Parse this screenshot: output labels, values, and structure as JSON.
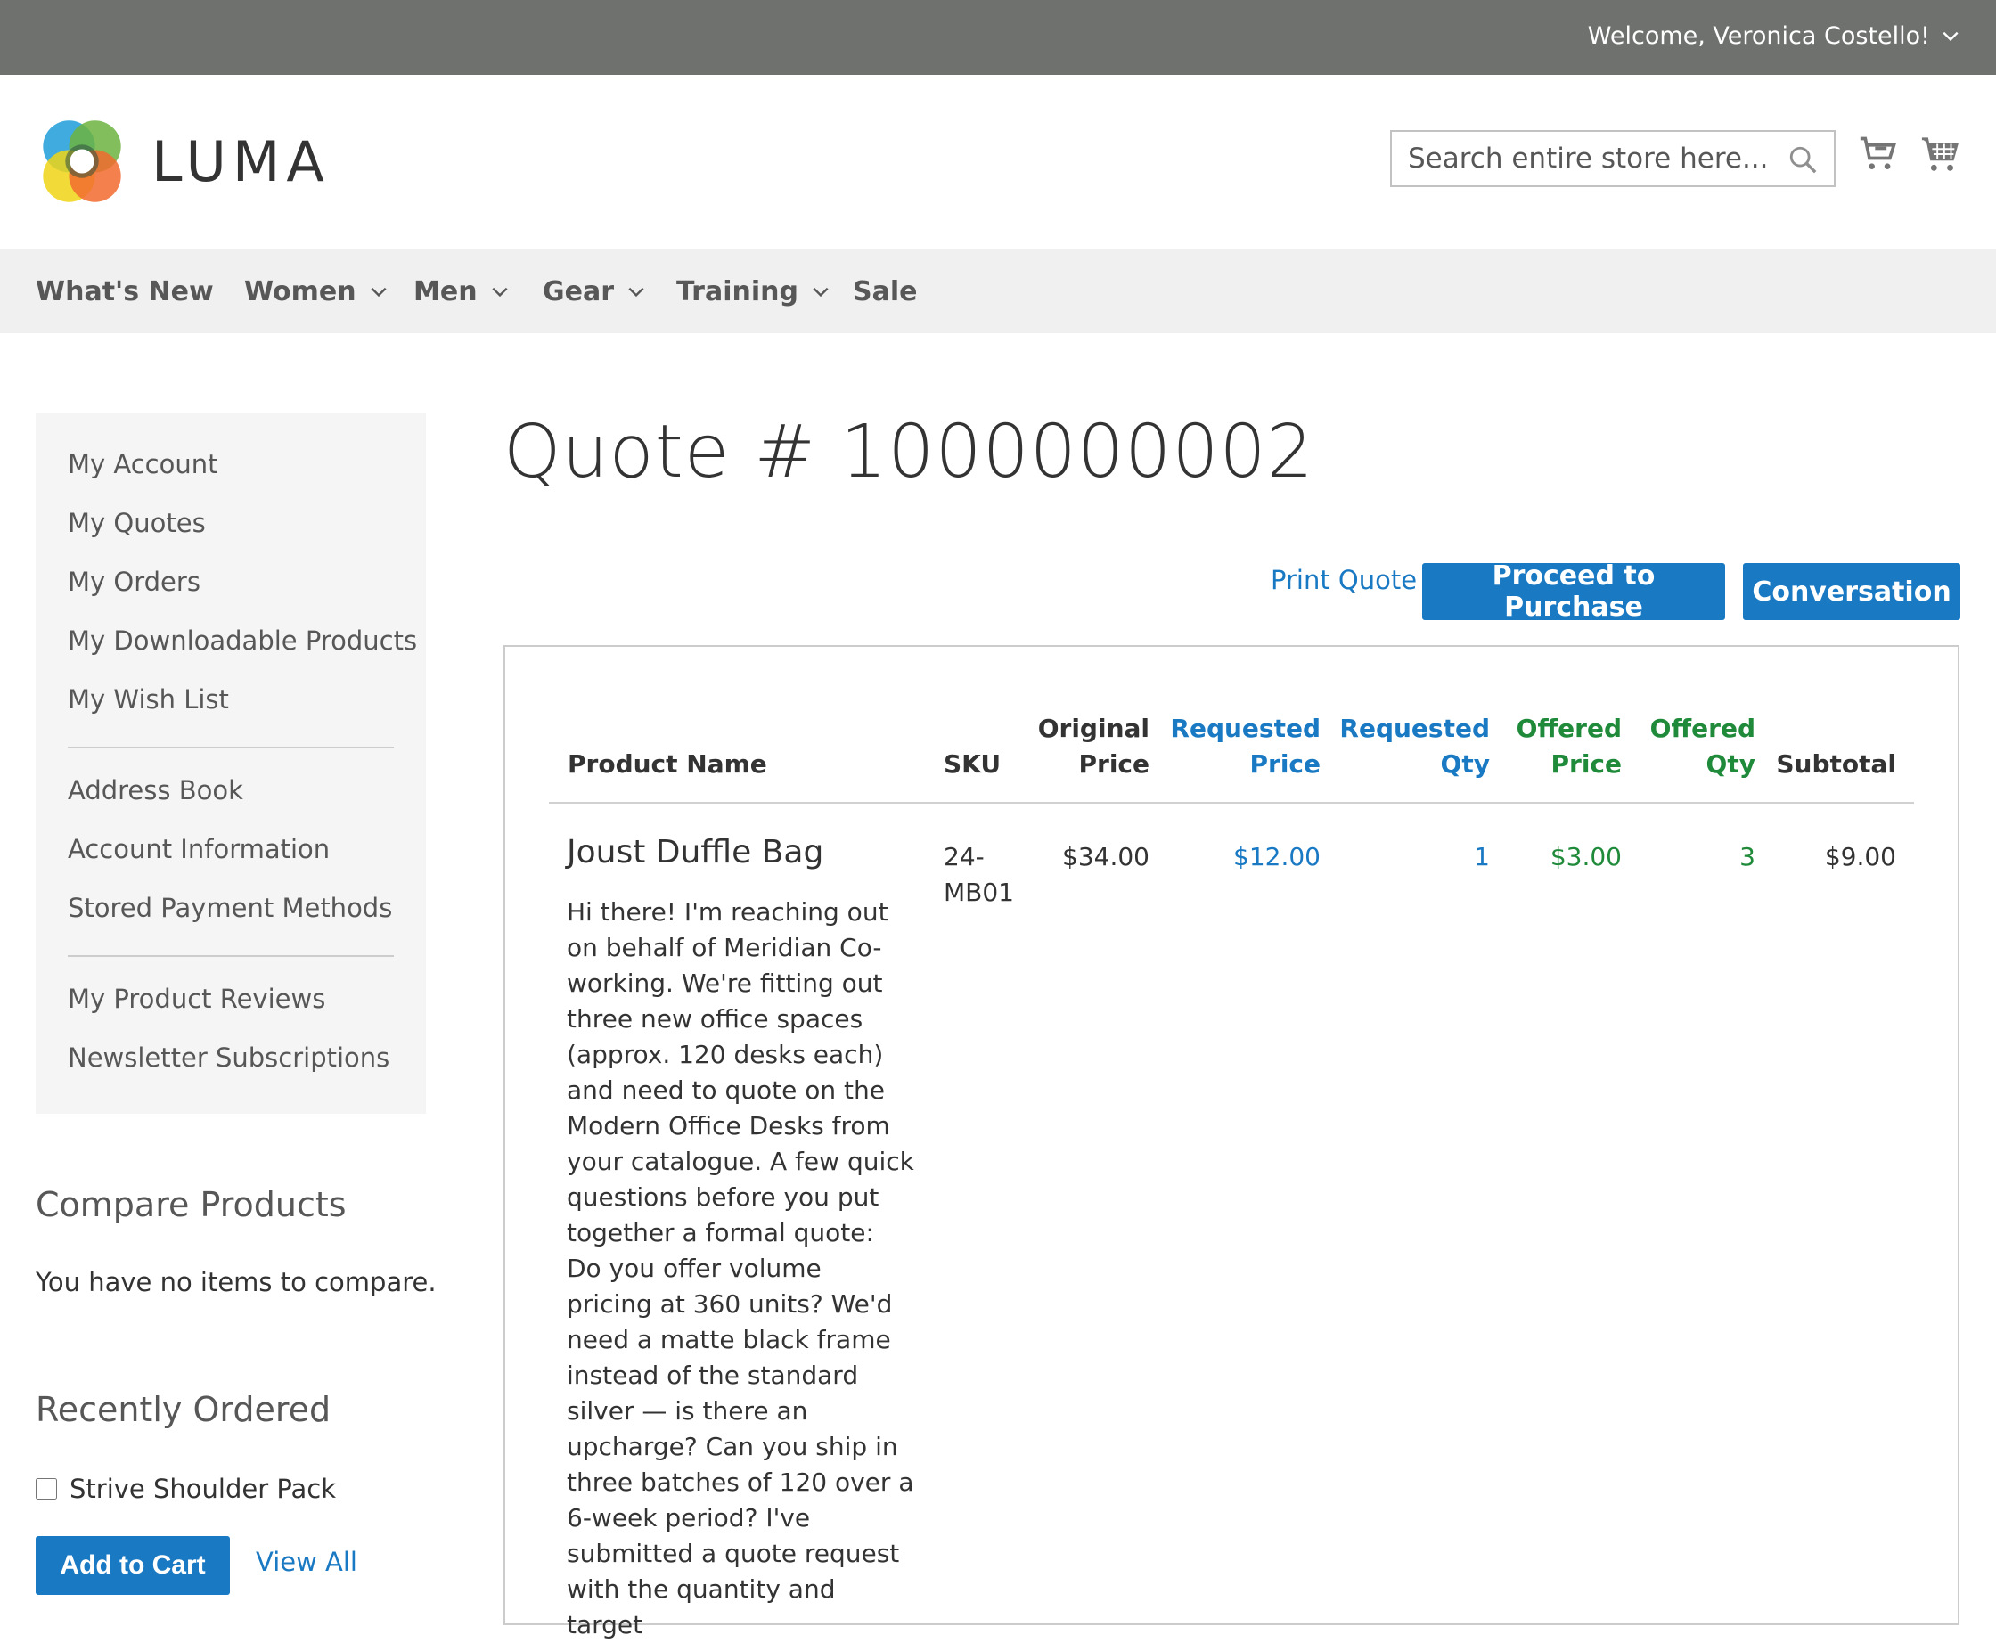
{
  "topbar": {
    "welcome": "Welcome, Veronica Costello!"
  },
  "header": {
    "logo_text": "LUMA",
    "search_placeholder": "Search entire store here..."
  },
  "nav": {
    "items": [
      "What's New",
      "Women",
      "Men",
      "Gear",
      "Training",
      "Sale"
    ]
  },
  "sidebar": {
    "account_links": [
      "My Account",
      "My Quotes",
      "My Orders",
      "My Downloadable Products",
      "My Wish List"
    ],
    "info_links": [
      "Address Book",
      "Account Information",
      "Stored Payment Methods"
    ],
    "review_links": [
      "My Product Reviews",
      "Newsletter Subscriptions"
    ]
  },
  "compare": {
    "title": "Compare Products",
    "empty_text": "You have no items to compare."
  },
  "recently_ordered": {
    "title": "Recently Ordered",
    "item": "Strive Shoulder Pack",
    "add_to_cart": "Add to Cart",
    "view_all": "View All"
  },
  "quote": {
    "title": "Quote # 1000000002",
    "print_label": "Print Quote",
    "proceed_label": "Proceed to Purchase",
    "conversation_label": "Conversation"
  },
  "table": {
    "headers": {
      "product_name": "Product Name",
      "sku": "SKU",
      "original_price": [
        "Original",
        "Price"
      ],
      "requested_price": [
        "Requested",
        "Price"
      ],
      "requested_qty": [
        "Requested",
        "Qty"
      ],
      "offered_price": [
        "Offered",
        "Price"
      ],
      "offered_qty": [
        "Offered",
        "Qty"
      ],
      "subtotal": "Subtotal"
    },
    "rows": [
      {
        "product_name": "Joust Duffle Bag",
        "note": "Hi there! I'm reaching out on behalf of Meridian Co-working. We're fitting out three new office spaces (approx. 120 desks each) and need to quote on the Modern Office Desks from your catalogue. A few quick questions before you put together a formal quote: Do you offer volume pricing at 360 units? We'd need a matte black frame instead of the standard silver — is there an upcharge? Can you ship in three batches of 120 over a 6-week period? I've submitted a quote request with the quantity and target",
        "sku": [
          "24-",
          "MB01"
        ],
        "original_price": "$34.00",
        "requested_price": "$12.00",
        "requested_qty": "1",
        "offered_price": "$3.00",
        "offered_qty": "3",
        "subtotal": "$9.00"
      }
    ]
  },
  "colors": {
    "topbar": "#6e716e",
    "nav_bg": "#f0f0f0",
    "sidebar_bg": "#f5f5f5",
    "primary_blue": "#1979c3",
    "offer_green": "#1f8a3a",
    "logo_blue": "#2aa2dc",
    "logo_green": "#6cb33f",
    "logo_yellow": "#f0d515",
    "logo_orange": "#f26b2e"
  }
}
